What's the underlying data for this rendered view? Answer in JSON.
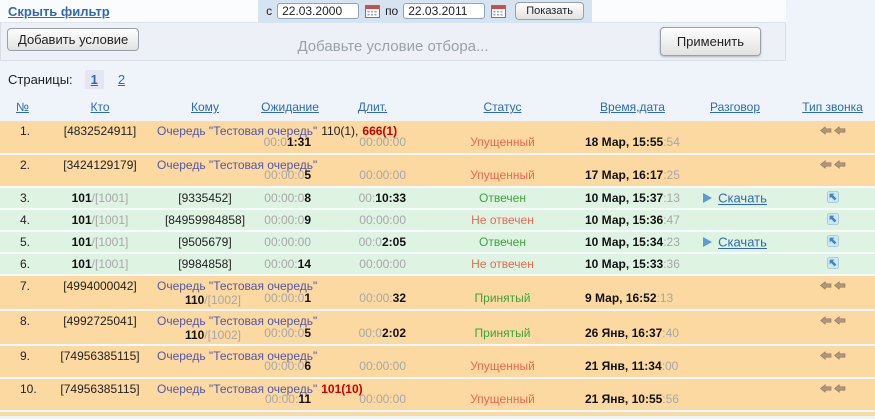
{
  "filter": {
    "toggle_link": "Скрыть фильтр",
    "date_from_label": "с",
    "date_from_value": "22.03.2000",
    "date_to_label": "по",
    "date_to_value": "22.03.2011",
    "show_button": "Показать",
    "add_condition_button": "Добавить условие",
    "condition_placeholder": "Добавьте условие отбора...",
    "apply_button": "Применить"
  },
  "pagination": {
    "label": "Страницы:",
    "pages": [
      {
        "label": "1",
        "current": true
      },
      {
        "label": "2",
        "current": false
      }
    ]
  },
  "icons": {
    "calendar": "calendar-icon",
    "play": "play-icon",
    "missed": "double-left-arrow-icon",
    "answered": "answered-call-arrow-icon"
  },
  "colors": {
    "row_missed_bg": "#fcd9a1",
    "row_answered_bg": "#def3e1",
    "status_ok": "#3aa63a",
    "status_fail": "#ec6752",
    "alert_red": "#cc0000",
    "queue_text": "#5156a8",
    "link_blue": "#2d6ab2"
  },
  "table": {
    "download_label": "Скачать",
    "columns": [
      "№",
      "Кто",
      "Кому",
      "Ожидание",
      "Длит.",
      "Статус",
      "Время,дата",
      "Разговор",
      "Тип звонка"
    ],
    "rows": [
      {
        "num": "1.",
        "who": "[4832524911]",
        "who_sub": "",
        "center": "",
        "queue": "Очередь \"Тестовая очередь\"",
        "plain": "110(1),",
        "alert": "666(1)",
        "member_b": "",
        "member_dim": "",
        "wait_dim": "00:0",
        "wait_b": "1:31",
        "dur_dim": "00:00:00",
        "dur_b": "",
        "status": "Упущенный",
        "status_ok": false,
        "date_b": "18 Мар, 15:55",
        "date_dim": ":54",
        "download": false,
        "icon": "missed",
        "two_line": true
      },
      {
        "num": "2.",
        "who": "[3424129179]",
        "who_sub": "",
        "center": "",
        "queue": "Очередь \"Тестовая очередь\"",
        "plain": "",
        "alert": "",
        "member_b": "",
        "member_dim": "",
        "wait_dim": "00:00:0",
        "wait_b": "5",
        "dur_dim": "00:00:00",
        "dur_b": "",
        "status": "Упущенный",
        "status_ok": false,
        "date_b": "17 Мар, 16:17",
        "date_dim": ":25",
        "download": false,
        "icon": "missed",
        "two_line": true
      },
      {
        "num": "3.",
        "who": "101",
        "who_sub": "/[1001]",
        "center": "[9335452]",
        "queue": "",
        "plain": "",
        "alert": "",
        "member_b": "",
        "member_dim": "",
        "wait_dim": "00:00:0",
        "wait_b": "8",
        "dur_dim": "00:",
        "dur_b": "10:33",
        "status": "Отвечен",
        "status_ok": true,
        "date_b": "10 Мар, 15:37",
        "date_dim": ":13",
        "download": true,
        "icon": "answered",
        "two_line": false
      },
      {
        "num": "4.",
        "who": "101",
        "who_sub": "/[1001]",
        "center": "[84959984858]",
        "queue": "",
        "plain": "",
        "alert": "",
        "member_b": "",
        "member_dim": "",
        "wait_dim": "00:00:0",
        "wait_b": "9",
        "dur_dim": "00:00:00",
        "dur_b": "",
        "status": "Не отвечен",
        "status_ok": false,
        "date_b": "10 Мар, 15:36",
        "date_dim": ":47",
        "download": false,
        "icon": "answered",
        "two_line": false
      },
      {
        "num": "5.",
        "who": "101",
        "who_sub": "/[1001]",
        "center": "[9505679]",
        "queue": "",
        "plain": "",
        "alert": "",
        "member_b": "",
        "member_dim": "",
        "wait_dim": "00:00:00",
        "wait_b": "",
        "dur_dim": "00:0",
        "dur_b": "2:05",
        "status": "Отвечен",
        "status_ok": true,
        "date_b": "10 Мар, 15:34",
        "date_dim": ":23",
        "download": true,
        "icon": "answered",
        "two_line": false
      },
      {
        "num": "6.",
        "who": "101",
        "who_sub": "/[1001]",
        "center": "[9984858]",
        "queue": "",
        "plain": "",
        "alert": "",
        "member_b": "",
        "member_dim": "",
        "wait_dim": "00:00:",
        "wait_b": "14",
        "dur_dim": "00:00:00",
        "dur_b": "",
        "status": "Не отвечен",
        "status_ok": false,
        "date_b": "10 Мар, 15:33",
        "date_dim": ":36",
        "download": false,
        "icon": "answered",
        "two_line": false
      },
      {
        "num": "7.",
        "who": "[4994000042]",
        "who_sub": "",
        "center": "",
        "queue": "Очередь \"Тестовая очередь\"",
        "plain": "",
        "alert": "",
        "member_b": "110",
        "member_dim": "/[1002]",
        "wait_dim": "00:00:0",
        "wait_b": "1",
        "dur_dim": "00:00:",
        "dur_b": "32",
        "status": "Принятый",
        "status_ok": true,
        "date_b": "9 Мар, 16:52",
        "date_dim": ":13",
        "download": false,
        "icon": "missed",
        "two_line": true
      },
      {
        "num": "8.",
        "who": "[4992725041]",
        "who_sub": "",
        "center": "",
        "queue": "Очередь \"Тестовая очередь\"",
        "plain": "",
        "alert": "",
        "member_b": "110",
        "member_dim": "/[1002]",
        "wait_dim": "00:00:0",
        "wait_b": "5",
        "dur_dim": "00:0",
        "dur_b": "2:02",
        "status": "Принятый",
        "status_ok": true,
        "date_b": "26 Янв, 16:37",
        "date_dim": ":40",
        "download": false,
        "icon": "missed",
        "two_line": true
      },
      {
        "num": "9.",
        "who": "[74956385115]",
        "who_sub": "",
        "center": "",
        "queue": "Очередь \"Тестовая очередь\"",
        "plain": "",
        "alert": "",
        "member_b": "",
        "member_dim": "",
        "wait_dim": "00:00:0",
        "wait_b": "6",
        "dur_dim": "00:00:00",
        "dur_b": "",
        "status": "Упущенный",
        "status_ok": false,
        "date_b": "21 Янв, 11:34",
        "date_dim": ":00",
        "download": false,
        "icon": "missed",
        "two_line": true
      },
      {
        "num": "10.",
        "who": "[74956385115]",
        "who_sub": "",
        "center": "",
        "queue": "Очередь \"Тестовая очередь\"",
        "plain": "",
        "alert": "101(10)",
        "member_b": "",
        "member_dim": "",
        "wait_dim": "00:00:",
        "wait_b": "11",
        "dur_dim": "00:00:00",
        "dur_b": "",
        "status": "Упущенный",
        "status_ok": false,
        "date_b": "21 Янв, 10:55",
        "date_dim": ":56",
        "download": false,
        "icon": "missed",
        "two_line": true
      }
    ]
  }
}
